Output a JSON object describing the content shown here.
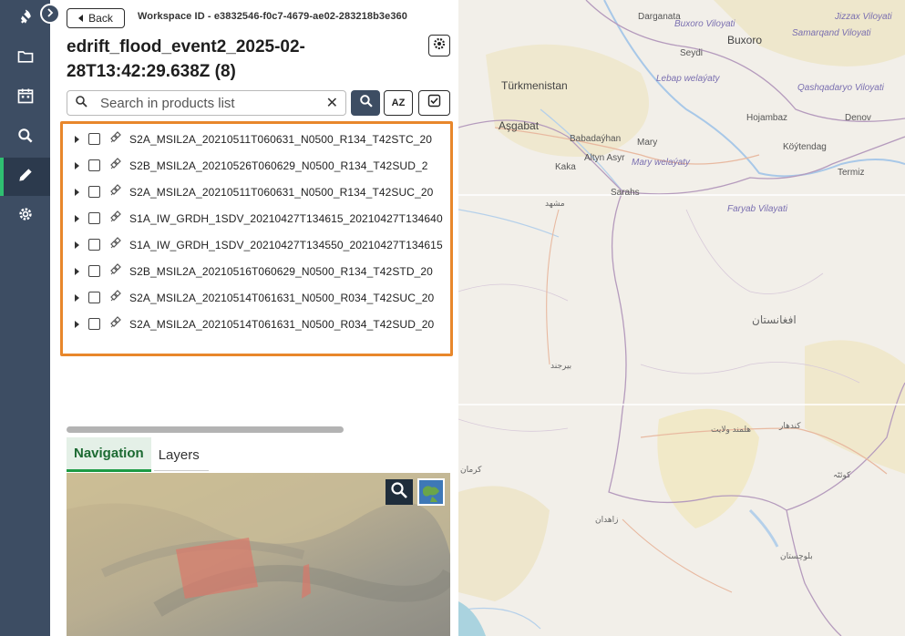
{
  "rail": {
    "items": [
      {
        "icon": "rocket-icon"
      },
      {
        "icon": "folder-icon"
      },
      {
        "icon": "calendar-icon"
      },
      {
        "icon": "search-icon"
      },
      {
        "icon": "pencil-icon",
        "active": true
      },
      {
        "icon": "gear-icon"
      }
    ],
    "accent": "#2fbf71"
  },
  "header": {
    "back_label": "Back",
    "workspace_id": "Workspace ID - e3832546-f0c7-4679-ae02-283218b3e360",
    "title": "edrift_flood_event2_2025-02-28T13:42:29.638Z (8)"
  },
  "search": {
    "placeholder": "Search in products list",
    "value": "",
    "sort_label": "AZ"
  },
  "products": [
    "S2A_MSIL2A_20210511T060631_N0500_R134_T42STC_20",
    "S2B_MSIL2A_20210526T060629_N0500_R134_T42SUD_2",
    "S2A_MSIL2A_20210511T060631_N0500_R134_T42SUC_20",
    "S1A_IW_GRDH_1SDV_20210427T134615_20210427T134640",
    "S1A_IW_GRDH_1SDV_20210427T134550_20210427T134615",
    "S2B_MSIL2A_20210516T060629_N0500_R134_T42STD_20",
    "S2A_MSIL2A_20210514T061631_N0500_R034_T42SUC_20",
    "S2A_MSIL2A_20210514T061631_N0500_R034_T42SUD_20"
  ],
  "tabs": [
    {
      "label": "Navigation",
      "active": true
    },
    {
      "label": "Layers",
      "active": false
    }
  ],
  "map_labels": {
    "darganata": "Darganata",
    "buxoro_vil": "Buxoro Viloyati",
    "buxoro": "Buxoro",
    "jizzax": "Jizzax Viloyati",
    "samarqand": "Samarqand Viloyati",
    "seydi": "Seydi",
    "turkmenistan": "Türkmenistan",
    "lebap": "Lebap welaýaty",
    "qashqadaryo": "Qashqadaryo Viloyati",
    "hojambaz": "Hojambaz",
    "denov": "Denov",
    "asgabat": "Aşgabat",
    "babadayhan": "Babadaýhan",
    "mary": "Mary",
    "koytendag": "Köýtendag",
    "altyn": "Altyn Asyr",
    "mary_vel": "Mary welaýaty",
    "kaka": "Kaka",
    "termiz": "Termiz",
    "saraks": "Sarahs",
    "faryab": "Faryab Vilayati",
    "afghanistan": "افغانستان",
    "mashhad": "مشهد",
    "kandahar": "کندهار",
    "zahedan": "زاهدان",
    "birjand": "بیرجند",
    "kerman": "کرمان",
    "helmand": "هلمند ولایت",
    "quetta": "کوئٹہ",
    "balochistan": "بلوچستان"
  }
}
